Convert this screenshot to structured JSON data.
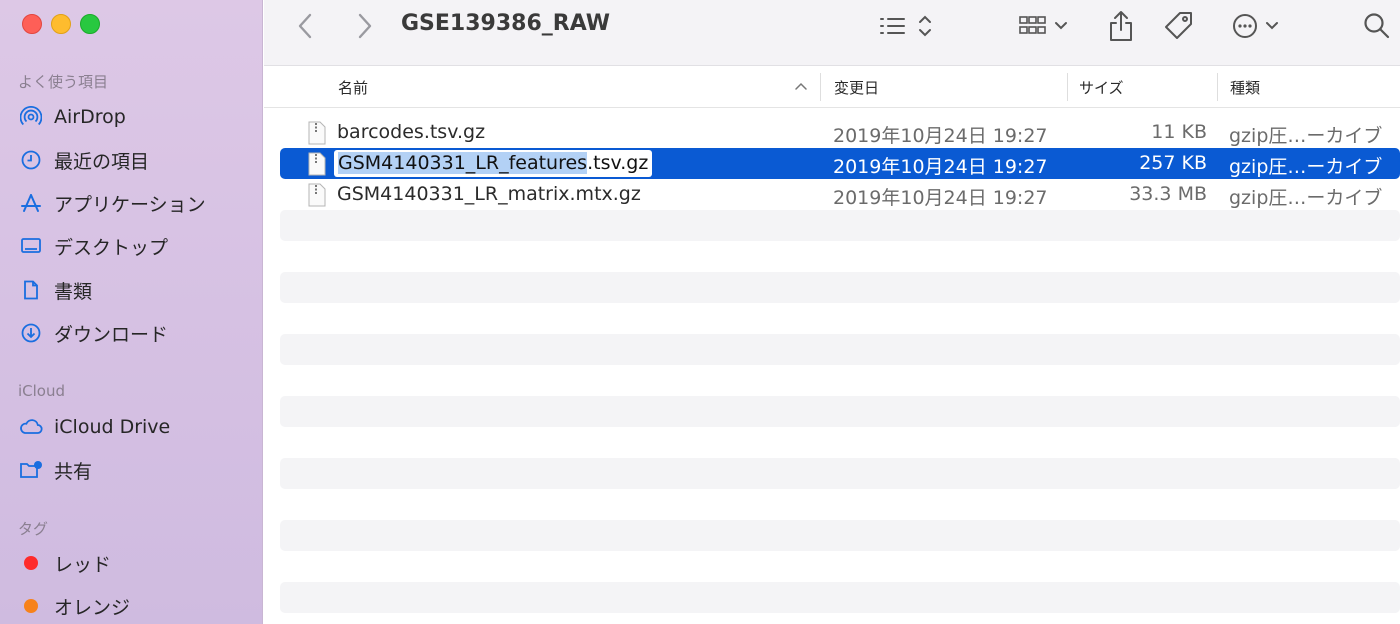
{
  "window": {
    "title": "GSE139386_RAW"
  },
  "sidebar": {
    "favorites_title": "よく使う項目",
    "favorites": [
      {
        "label": "AirDrop",
        "icon": "airdrop-icon"
      },
      {
        "label": "最近の項目",
        "icon": "clock-icon"
      },
      {
        "label": "アプリケーション",
        "icon": "applications-icon"
      },
      {
        "label": "デスクトップ",
        "icon": "desktop-icon"
      },
      {
        "label": "書類",
        "icon": "document-icon"
      },
      {
        "label": "ダウンロード",
        "icon": "download-icon"
      }
    ],
    "icloud_title": "iCloud",
    "icloud": [
      {
        "label": "iCloud Drive",
        "icon": "cloud-icon"
      },
      {
        "label": "共有",
        "icon": "shared-folder-icon"
      }
    ],
    "tags_title": "タグ",
    "tags": [
      {
        "label": "レッド",
        "color": "#fe2b2b"
      },
      {
        "label": "オレンジ",
        "color": "#f7821b"
      }
    ]
  },
  "columns": {
    "name": "名前",
    "date": "変更日",
    "size": "サイズ",
    "kind": "種類"
  },
  "files": [
    {
      "name": "barcodes.tsv.gz",
      "date": "2019年10月24日 19:27",
      "size": "11 KB",
      "kind": "gzip圧…ーカイブ"
    },
    {
      "name_selected_part": "GSM4140331_LR_features",
      "name_rest": ".tsv.gz",
      "date": "2019年10月24日 19:27",
      "size": "257 KB",
      "kind": "gzip圧…ーカイブ"
    },
    {
      "name": "GSM4140331_LR_matrix.mtx.gz",
      "date": "2019年10月24日 19:27",
      "size": "33.3 MB",
      "kind": "gzip圧…ーカイブ"
    }
  ],
  "colors": {
    "selection": "#0a5ad3",
    "accent": "#1a6ee0"
  }
}
